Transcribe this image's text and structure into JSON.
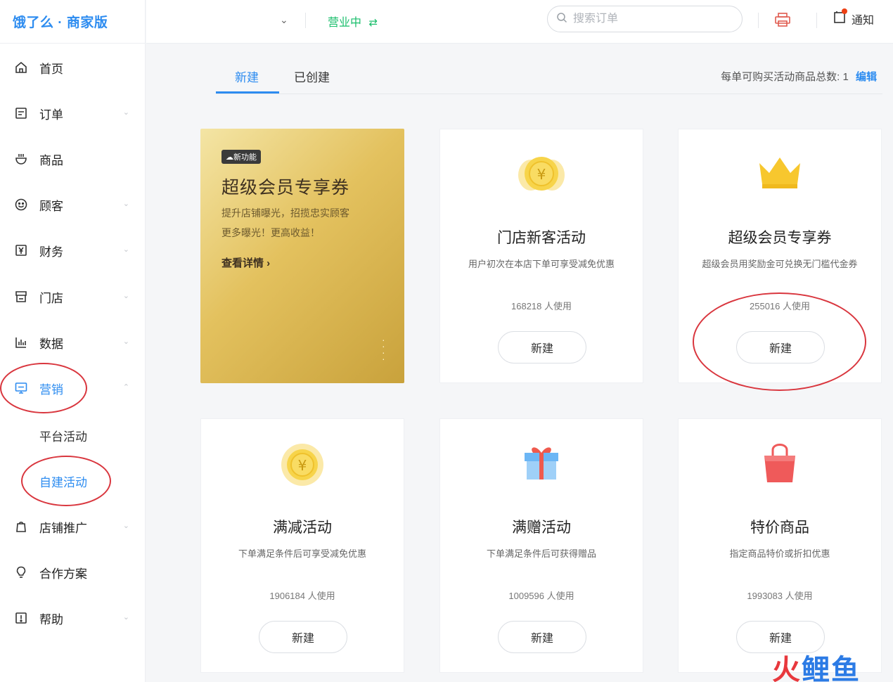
{
  "app": {
    "brand": "饿了么 · 商家版"
  },
  "sidebar": {
    "items": [
      {
        "key": "home",
        "label": "首页",
        "icon": "home-icon",
        "has_chevron": false
      },
      {
        "key": "orders",
        "label": "订单",
        "icon": "order-icon",
        "has_chevron": true
      },
      {
        "key": "products",
        "label": "商品",
        "icon": "product-icon",
        "has_chevron": false
      },
      {
        "key": "customers",
        "label": "顾客",
        "icon": "smile-icon",
        "has_chevron": true
      },
      {
        "key": "finance",
        "label": "财务",
        "icon": "yen-icon",
        "has_chevron": true
      },
      {
        "key": "store",
        "label": "门店",
        "icon": "store-icon",
        "has_chevron": true
      },
      {
        "key": "data",
        "label": "数据",
        "icon": "bar-chart-icon",
        "has_chevron": true
      },
      {
        "key": "marketing",
        "label": "营销",
        "icon": "monitor-icon",
        "has_chevron": true,
        "active": true
      },
      {
        "key": "promotion",
        "label": "店铺推广",
        "icon": "shop-icon",
        "has_chevron": true
      },
      {
        "key": "partner",
        "label": "合作方案",
        "icon": "bulb-icon",
        "has_chevron": false
      },
      {
        "key": "help",
        "label": "帮助",
        "icon": "help-icon",
        "has_chevron": true
      }
    ],
    "subitems": [
      {
        "label": "平台活动",
        "active": false
      },
      {
        "label": "自建活动",
        "active": true
      }
    ]
  },
  "topbar": {
    "status": "营业中",
    "search_placeholder": "搜索订单",
    "notice_label": "通知"
  },
  "tabs": [
    {
      "label": "新建",
      "active": true
    },
    {
      "label": "已创建",
      "active": false
    }
  ],
  "limit": {
    "text": "每单可购买活动商品总数: 1",
    "edit_label": "编辑"
  },
  "promo": {
    "badge": "新功能",
    "title": "超级会员专享券",
    "desc_line1": "提升店铺曝光，招揽忠实顾客",
    "desc_line2": "更多曝光！更高收益！",
    "link": "查看详情 ›"
  },
  "cards": [
    {
      "title": "门店新客活动",
      "desc": "用户初次在本店下单可享受减免优惠",
      "users": "168218 人使用",
      "button": "新建",
      "icon": "coin-stack-icon"
    },
    {
      "title": "超级会员专享券",
      "desc": "超级会员用奖励金可兑换无门槛代金券",
      "users": "255016 人使用",
      "button": "新建",
      "icon": "crown-icon"
    },
    {
      "title": "满减活动",
      "desc": "下单满足条件后可享受减免优惠",
      "users": "1906184 人使用",
      "button": "新建",
      "icon": "coin-icon"
    },
    {
      "title": "满赠活动",
      "desc": "下单满足条件后可获得赠品",
      "users": "1009596 人使用",
      "button": "新建",
      "icon": "gift-icon"
    },
    {
      "title": "特价商品",
      "desc": "指定商品特价或折扣优惠",
      "users": "1993083 人使用",
      "button": "新建",
      "icon": "shopping-bag-icon"
    }
  ],
  "watermark": {
    "part1": "火",
    "part2": "鲤鱼"
  },
  "colors": {
    "accent": "#2d8cf0",
    "open_status": "#19be6b",
    "annotation_red": "#d9363e"
  }
}
